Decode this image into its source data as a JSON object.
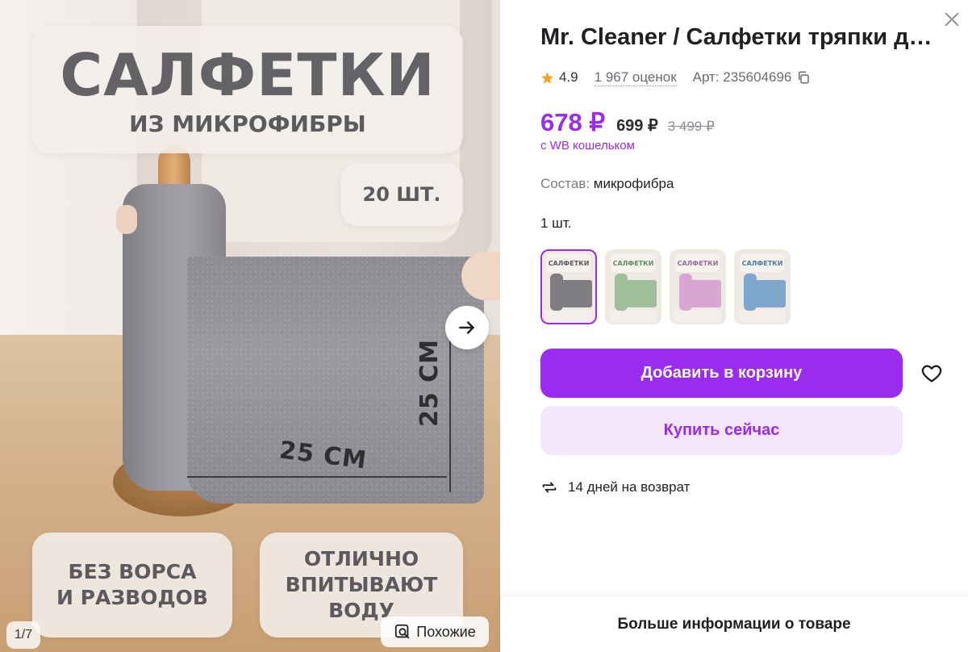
{
  "gallery": {
    "title_big": "САЛФЕТКИ",
    "title_small": "ИЗ МИКРОФИБРЫ",
    "count_label": "20 ШТ.",
    "dimension_horizontal": "25 СМ",
    "dimension_vertical": "25 СМ",
    "feature_lint_line1": "БЕЗ ВОРСА",
    "feature_lint_line2": "И РАЗВОДОВ",
    "feature_absorb_line1": "ОТЛИЧНО",
    "feature_absorb_line2": "ВПИТЫВАЮТ",
    "feature_absorb_line3": "ВОДУ",
    "position_counter": "1/7",
    "similar_label": "Похожие",
    "next_icon": "arrow-right-icon"
  },
  "product": {
    "title": "Mr. Cleaner / Салфетки тряпки для уборки из микрофибры",
    "rating": "4.9",
    "reviews": "1 967 оценок",
    "article": "Арт: 235604696",
    "price_wallet": "678 ₽",
    "price_regular": "699 ₽",
    "price_old": "3 499 ₽",
    "wallet_note": "с WB кошельком",
    "composition_label": "Состав:",
    "composition_value": "микрофибра",
    "quantity": "1 шт."
  },
  "variants": [
    {
      "label": "САЛФЕТКИ",
      "color": "#7d7d82",
      "label_color": "#5a5a60"
    },
    {
      "label": "САЛФЕТКИ",
      "color": "#9fbf9a",
      "label_color": "#5f8f5a"
    },
    {
      "label": "САЛФЕТКИ",
      "color": "#d9a6d4",
      "label_color": "#9a6a9a"
    },
    {
      "label": "САЛФЕТКИ",
      "color": "#7ea6cc",
      "label_color": "#4f7aa6"
    }
  ],
  "actions": {
    "add_to_cart": "Добавить в корзину",
    "buy_now": "Купить сейчас",
    "returns": "14 дней на возврат",
    "more_info": "Больше информации о товаре"
  },
  "colors": {
    "accent": "#9a2bf0",
    "accent_light": "#f4e6fd",
    "star": "#f5a623"
  }
}
